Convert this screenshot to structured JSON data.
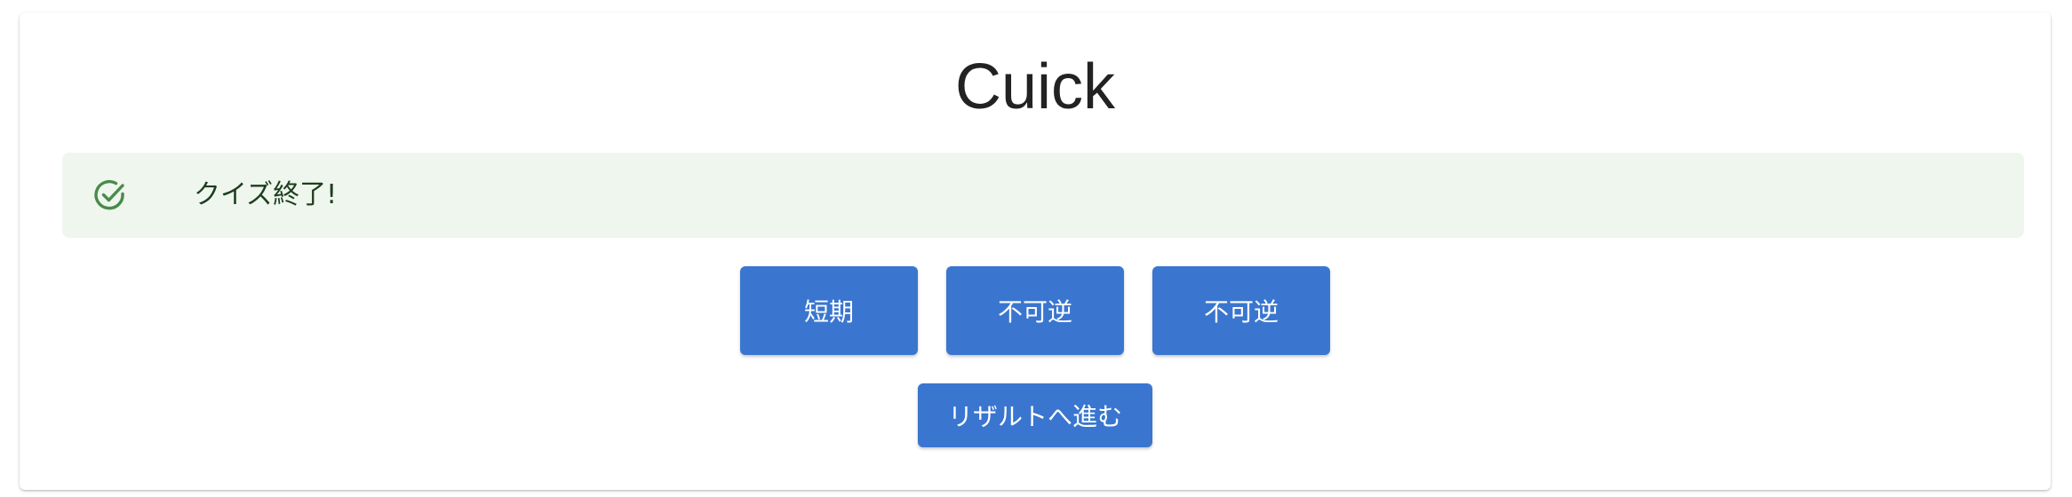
{
  "app": {
    "title": "Cuick"
  },
  "alert": {
    "icon": "check-circle-icon",
    "message": "クイズ終了!",
    "color": "#4a8a4a",
    "background": "#eef6ee"
  },
  "choices": [
    {
      "label": "短期"
    },
    {
      "label": "不可逆"
    },
    {
      "label": "不可逆"
    }
  ],
  "actions": {
    "next_label": "リザルトへ進む"
  },
  "colors": {
    "primary": "#3a76d0",
    "button_text": "#ffffff"
  }
}
